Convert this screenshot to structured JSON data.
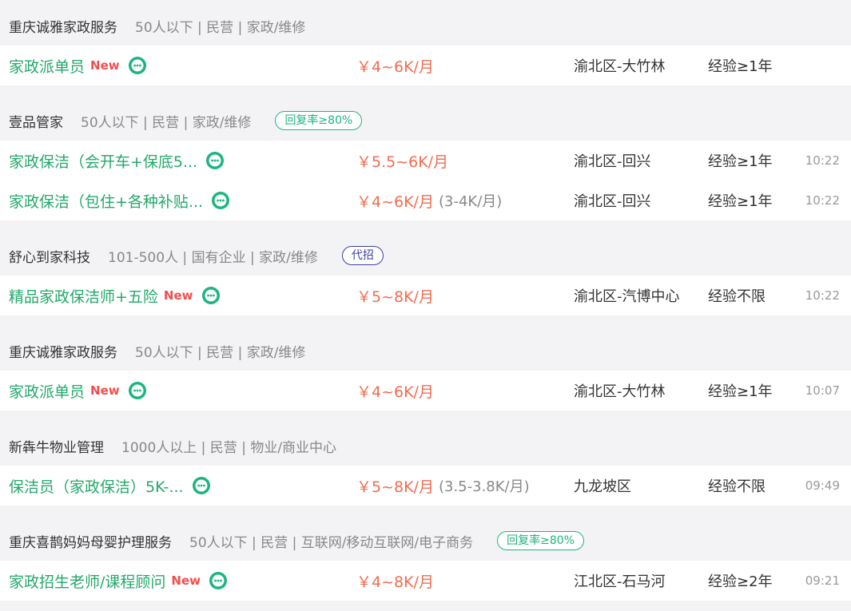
{
  "groups": [
    {
      "company": {
        "name": "重庆诚雅家政服务",
        "meta": "50人以下 | 民营 | 家政/维修",
        "tag": "",
        "tag_style": ""
      },
      "jobs": [
        {
          "title": "家政派单员",
          "new": "New",
          "salary": "￥4~6K/月",
          "salary_extra": "",
          "location": "渝北区-大竹林",
          "experience": "经验≥1年",
          "time": ""
        }
      ]
    },
    {
      "company": {
        "name": "壹品管家",
        "meta": "50人以下 | 民营 | 家政/维修",
        "tag": "回复率≥80%",
        "tag_style": "green"
      },
      "jobs": [
        {
          "title": "家政保洁（会开车+保底5...",
          "new": "",
          "salary": "￥5.5~6K/月",
          "salary_extra": "",
          "location": "渝北区-回兴",
          "experience": "经验≥1年",
          "time": "10:22"
        },
        {
          "title": "家政保洁（包住+各种补贴...",
          "new": "",
          "salary": "￥4~6K/月",
          "salary_extra": "(3-4K/月)",
          "location": "渝北区-回兴",
          "experience": "经验≥1年",
          "time": "10:22"
        }
      ]
    },
    {
      "company": {
        "name": "舒心到家科技",
        "meta": "101-500人 | 国有企业 | 家政/维修",
        "tag": "代招",
        "tag_style": "blue"
      },
      "jobs": [
        {
          "title": "精品家政保洁师+五险",
          "new": "New",
          "salary": "￥5~8K/月",
          "salary_extra": "",
          "location": "渝北区-汽博中心",
          "experience": "经验不限",
          "time": "10:22"
        }
      ]
    },
    {
      "company": {
        "name": "重庆诚雅家政服务",
        "meta": "50人以下 | 民营 | 家政/维修",
        "tag": "",
        "tag_style": ""
      },
      "jobs": [
        {
          "title": "家政派单员",
          "new": "New",
          "salary": "￥4~6K/月",
          "salary_extra": "",
          "location": "渝北区-大竹林",
          "experience": "经验≥1年",
          "time": "10:07"
        }
      ]
    },
    {
      "company": {
        "name": "新犇牛物业管理",
        "meta": "1000人以上 | 民营 | 物业/商业中心",
        "tag": "",
        "tag_style": ""
      },
      "jobs": [
        {
          "title": "保洁员（家政保洁）5K-...",
          "new": "",
          "salary": "￥5~8K/月",
          "salary_extra": "(3.5-3.8K/月)",
          "location": "九龙坡区",
          "experience": "经验不限",
          "time": "09:49"
        }
      ]
    },
    {
      "company": {
        "name": "重庆喜鹊妈妈母婴护理服务",
        "meta": "50人以下 | 民营 | 互联网/移动互联网/电子商务",
        "tag": "回复率≥80%",
        "tag_style": "green"
      },
      "jobs": [
        {
          "title": "家政招生老师/课程顾问",
          "new": "New",
          "salary": "￥4~8K/月",
          "salary_extra": "",
          "location": "江北区-石马河",
          "experience": "经验≥2年",
          "time": "09:21"
        }
      ]
    }
  ]
}
